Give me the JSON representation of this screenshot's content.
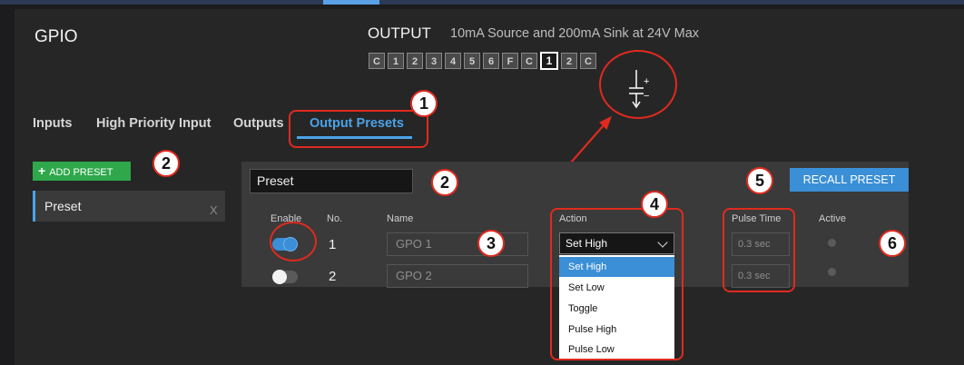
{
  "app": {
    "title": "GPIO"
  },
  "output": {
    "label": "OUTPUT",
    "description": "10mA Source and 200mA Sink at 24V Max",
    "pins": [
      "C",
      "1",
      "2",
      "3",
      "4",
      "5",
      "6",
      "F",
      "C",
      "1",
      "2",
      "C"
    ],
    "selected_pin_index": 9,
    "zoom_symbol_plus": "+",
    "zoom_symbol_minus": "−"
  },
  "tabs": [
    {
      "label": "Inputs",
      "active": false
    },
    {
      "label": "High Priority Input",
      "active": false
    },
    {
      "label": "Outputs",
      "active": false
    },
    {
      "label": "Output Presets",
      "active": true
    }
  ],
  "sidebar": {
    "add_button_label": "ADD PRESET",
    "add_button_icon": "plus-icon",
    "presets": [
      {
        "label": "Preset",
        "remove": "X"
      }
    ]
  },
  "editor": {
    "preset_name": "Preset",
    "recall_label": "RECALL PRESET",
    "columns": {
      "enable": "Enable",
      "no": "No.",
      "name": "Name",
      "action": "Action",
      "pulse_time": "Pulse Time",
      "active": "Active"
    },
    "rows": [
      {
        "enabled": true,
        "no": "1",
        "name": "GPO 1",
        "action": "Set High",
        "pulse_time": "0.3 sec",
        "active": false
      },
      {
        "enabled": false,
        "no": "2",
        "name": "GPO 2",
        "action": "",
        "pulse_time": "0.3 sec",
        "active": false
      }
    ],
    "action_options": [
      "Set High",
      "Set Low",
      "Toggle",
      "Pulse High",
      "Pulse Low"
    ],
    "action_selected": "Set High"
  },
  "annotations": [
    "1",
    "2",
    "2",
    "3",
    "4",
    "5",
    "6"
  ],
  "colors": {
    "accent": "#3a8fd6",
    "add_green": "#2ea84b",
    "callout_red": "#e02a1f",
    "background": "#262626"
  }
}
